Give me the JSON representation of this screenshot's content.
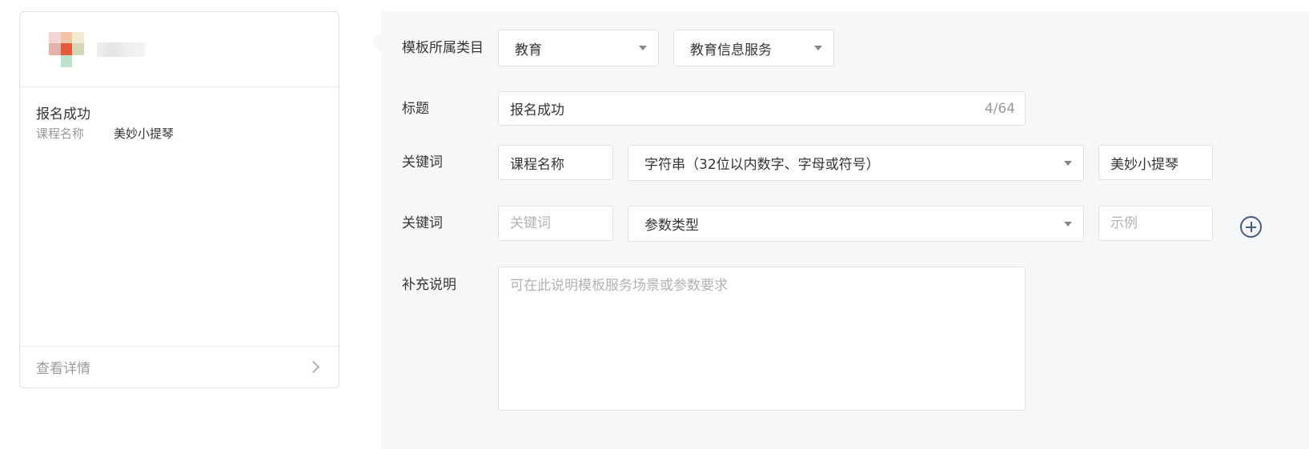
{
  "preview": {
    "message_title": "报名成功",
    "keyword_name": "课程名称",
    "keyword_value": "美妙小提琴",
    "footer_label": "查看详情",
    "avatar_colors": [
      "#f3d6d3",
      "#f0c7a6",
      "#f3ead2",
      "#e3b0ab",
      "#e45a3c",
      "#d5d8b6",
      "#ffffff",
      "#bfe0cc",
      "#ffffff"
    ]
  },
  "form": {
    "category": {
      "label": "模板所属类目",
      "primary_value": "教育",
      "secondary_value": "教育信息服务"
    },
    "title": {
      "label": "标题",
      "value": "报名成功",
      "counter": "4/64"
    },
    "keyword_row_1": {
      "label": "关键词",
      "name_value": "课程名称",
      "type_value": "字符串（32位以内数字、字母或符号）",
      "example_value": "美妙小提琴"
    },
    "keyword_row_2": {
      "label": "关键词",
      "name_placeholder": "关键词",
      "type_placeholder": "参数类型",
      "example_placeholder": "示例"
    },
    "note": {
      "label": "补充说明",
      "placeholder": "可在此说明模板服务场景或参数要求"
    }
  },
  "icons": {
    "add": "plus-circle-icon",
    "dropdown": "caret-down-icon",
    "chevron": "chevron-right-icon"
  }
}
